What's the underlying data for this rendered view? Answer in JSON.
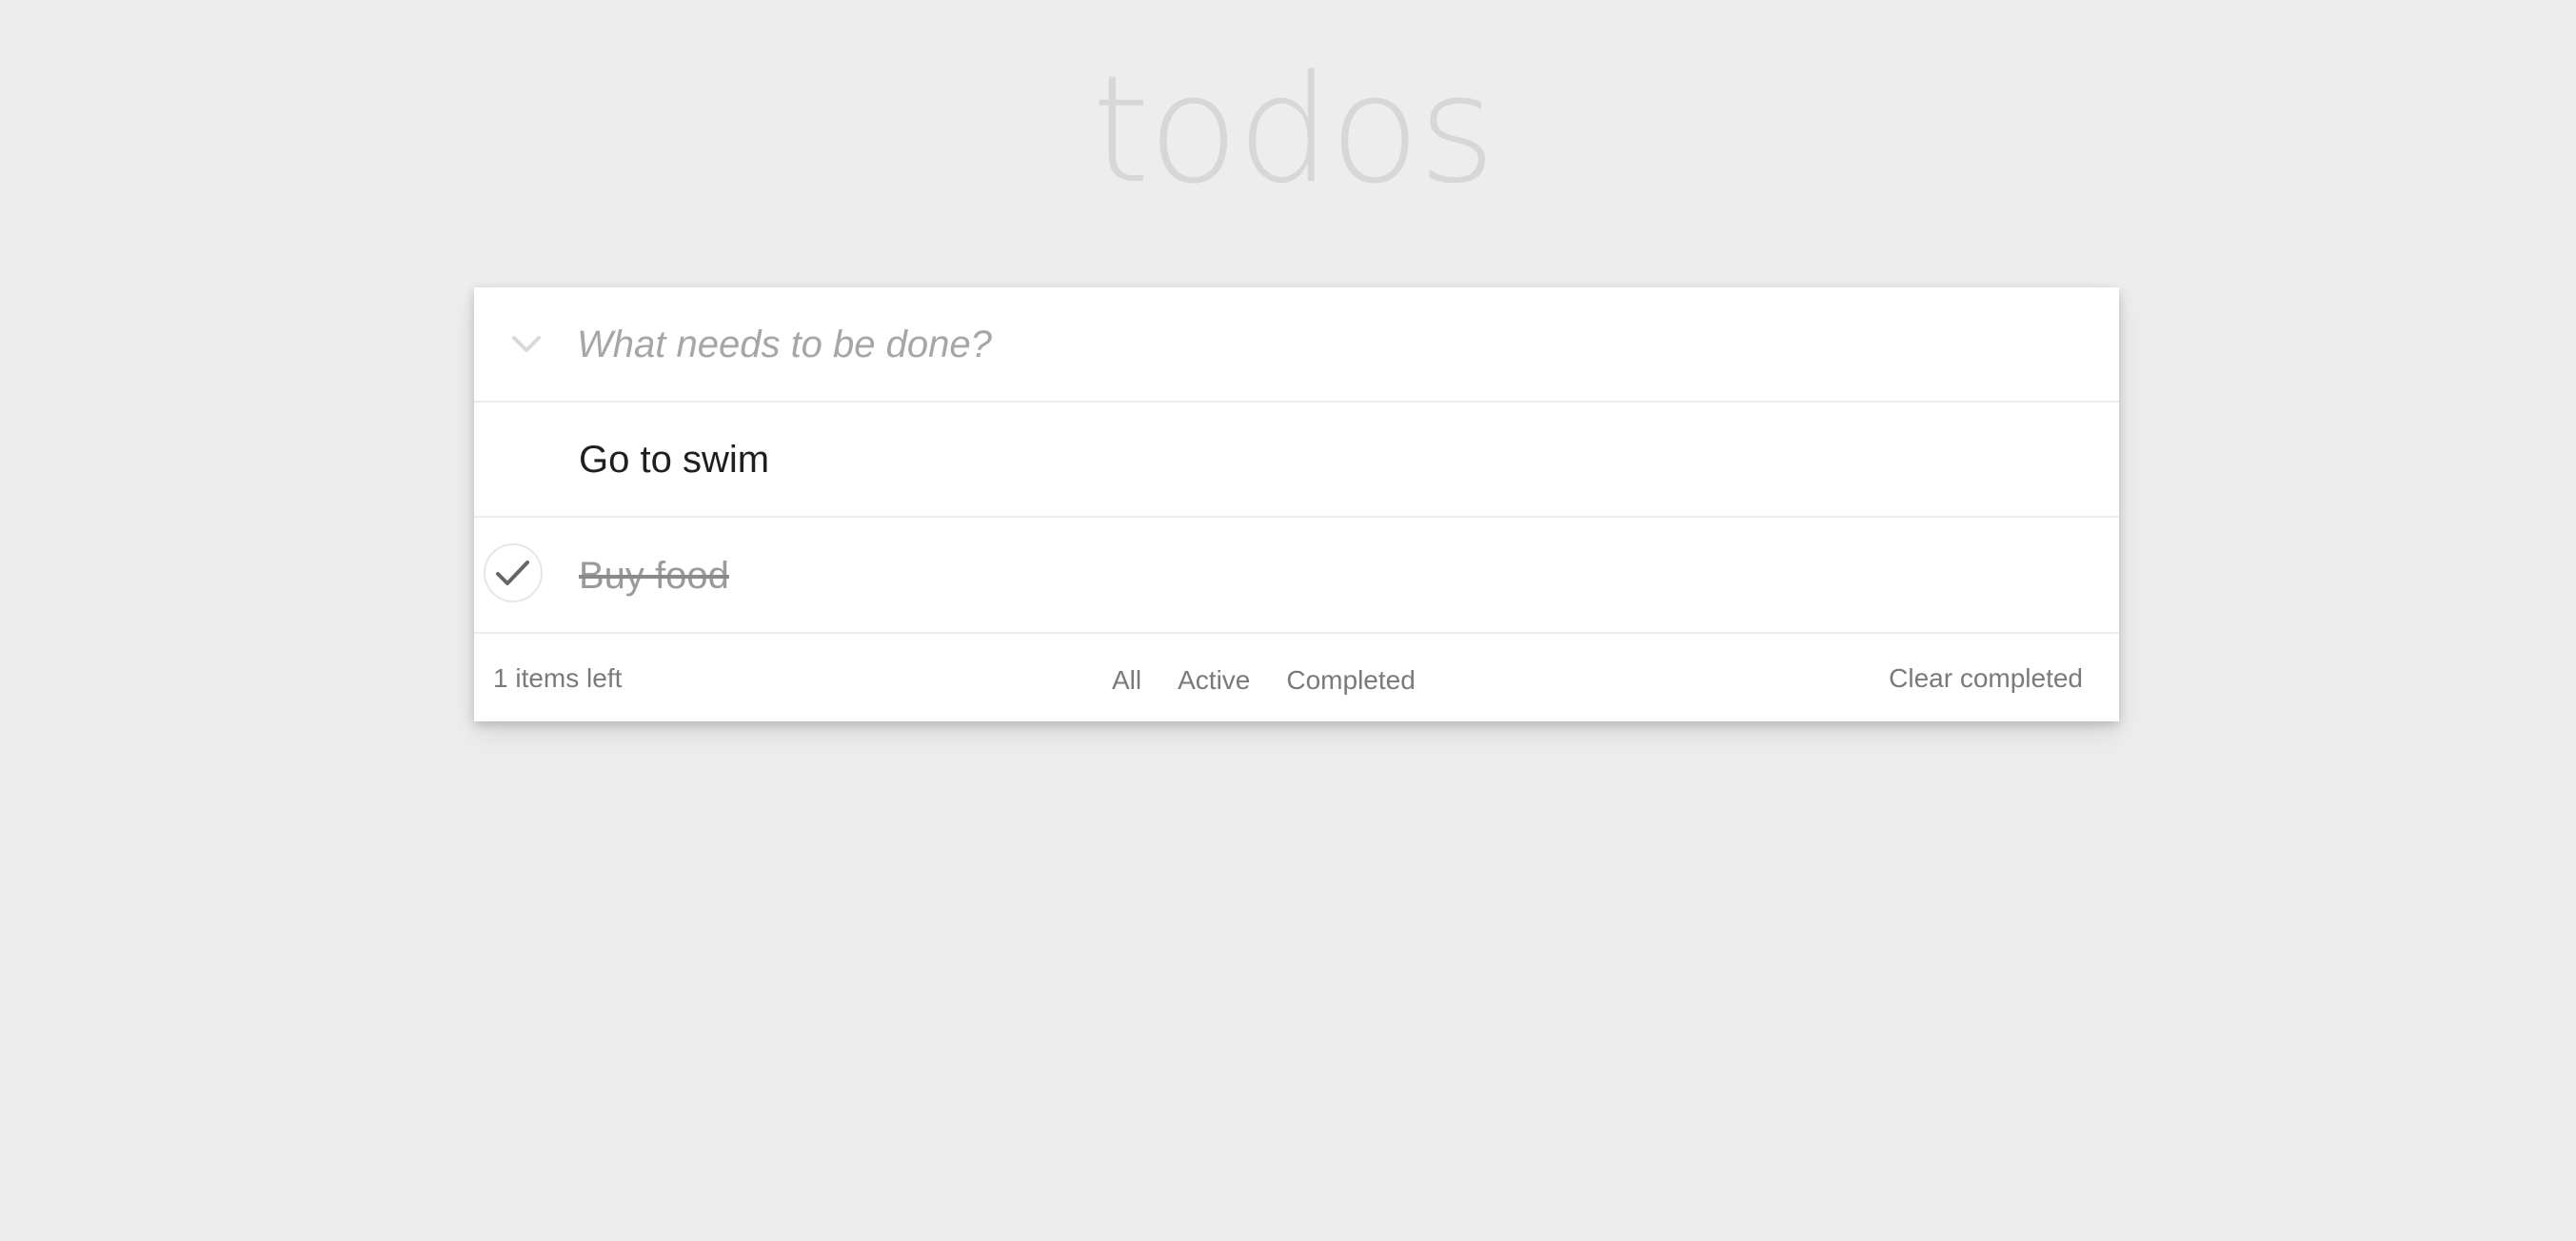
{
  "app": {
    "title": "todos"
  },
  "new_todo": {
    "placeholder": "What needs to be done?",
    "value": ""
  },
  "todos": [
    {
      "label": "Go to swim",
      "completed": false
    },
    {
      "label": "Buy food",
      "completed": true
    }
  ],
  "footer": {
    "items_left": "1 items left",
    "filters": [
      {
        "label": "All"
      },
      {
        "label": "Active"
      },
      {
        "label": "Completed"
      }
    ],
    "clear_completed": "Clear completed"
  },
  "colors": {
    "background": "#ededed",
    "card": "#ffffff",
    "title": "#d7d7d7",
    "muted_text": "#7a7a7a",
    "checkmark": "#666666"
  }
}
